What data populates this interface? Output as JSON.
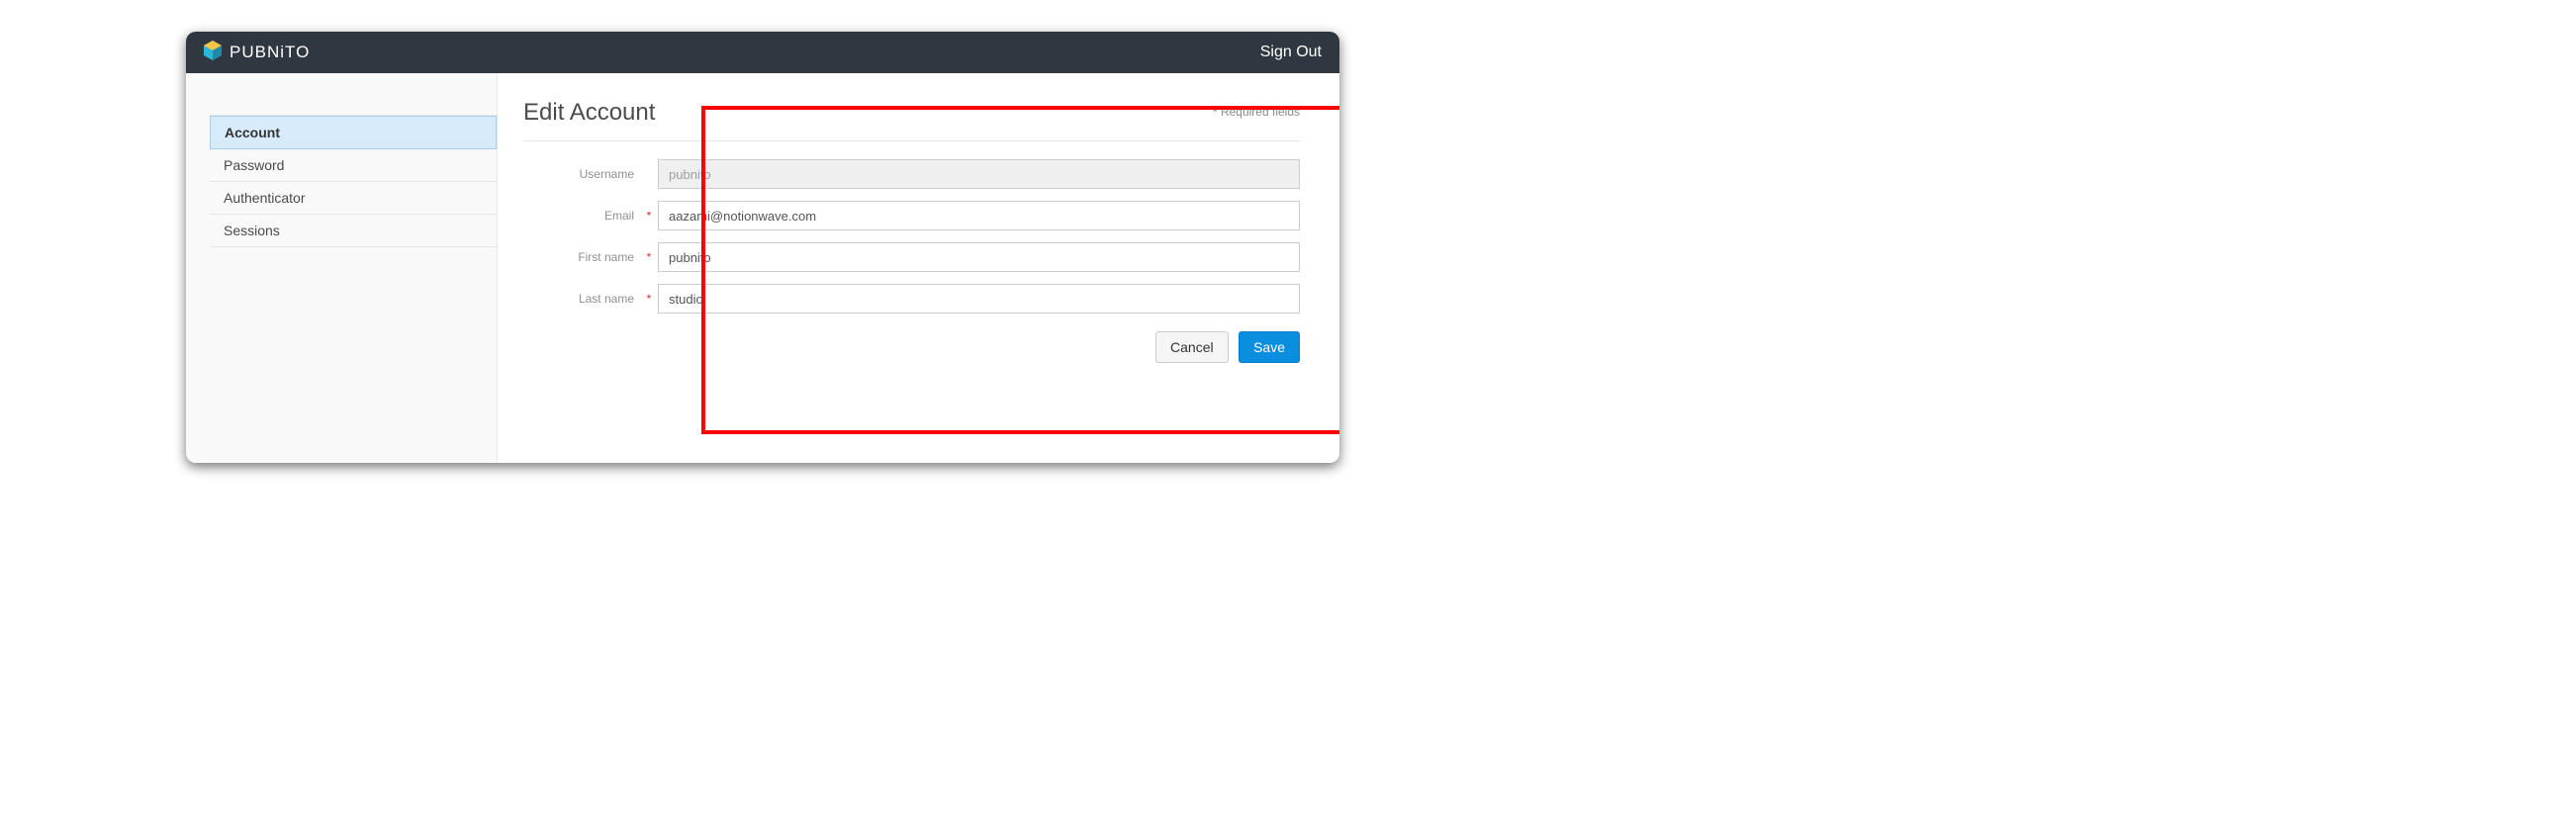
{
  "header": {
    "brand": "PUBNiTO",
    "signout": "Sign Out"
  },
  "sidebar": {
    "items": [
      {
        "label": "Account",
        "active": true
      },
      {
        "label": "Password",
        "active": false
      },
      {
        "label": "Authenticator",
        "active": false
      },
      {
        "label": "Sessions",
        "active": false
      }
    ]
  },
  "page": {
    "title": "Edit Account",
    "required_note": "Required fields"
  },
  "form": {
    "username": {
      "label": "Username",
      "value": "pubnito",
      "required": false,
      "disabled": true
    },
    "email": {
      "label": "Email",
      "value": "aazami@notionwave.com",
      "required": true,
      "disabled": false
    },
    "first_name": {
      "label": "First name",
      "value": "pubnito",
      "required": true,
      "disabled": false
    },
    "last_name": {
      "label": "Last name",
      "value": "studio",
      "required": true,
      "disabled": false
    }
  },
  "actions": {
    "cancel": "Cancel",
    "save": "Save"
  }
}
